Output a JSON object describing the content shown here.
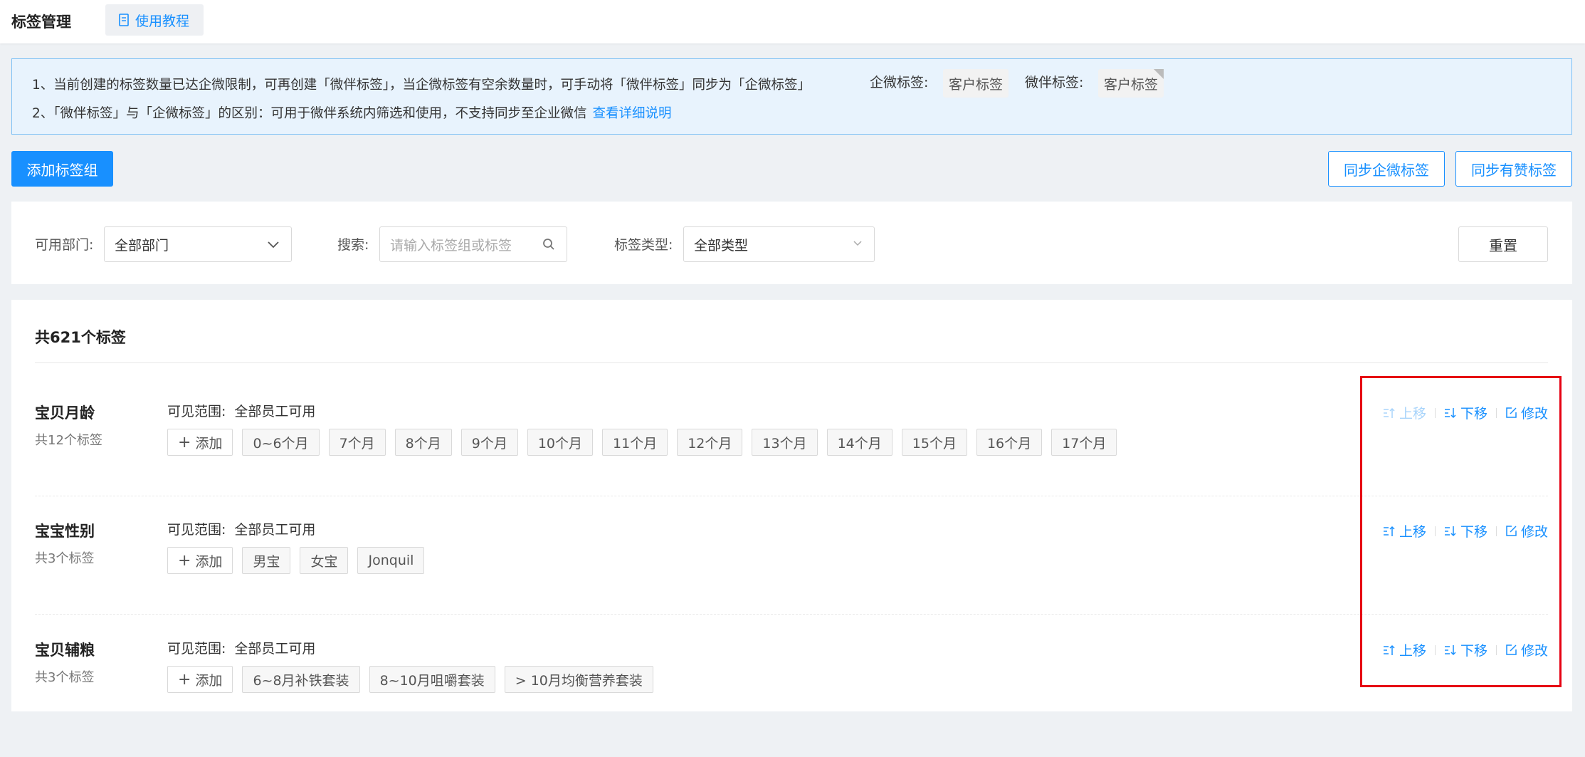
{
  "header": {
    "title": "标签管理",
    "tutorial_label": "使用教程"
  },
  "notice": {
    "line1": "1、当前创建的标签数量已达企微限制，可再创建「微伴标签」，当企微标签有空余数量时，可手动将「微伴标签」同步为「企微标签」",
    "line2": "2、「微伴标签」与「企微标签」的区别：可用于微伴系统内筛选和使用，不支持同步至企业微信",
    "line2_link": "查看详细说明",
    "qiwei_label": "企微标签:",
    "qiwei_chip": "客户标签",
    "weiban_label": "微伴标签:",
    "weiban_chip": "客户标签"
  },
  "toolbar": {
    "add_group": "添加标签组",
    "sync_qiwei": "同步企微标签",
    "sync_youzan": "同步有赞标签"
  },
  "filters": {
    "dept_label": "可用部门:",
    "dept_value": "全部部门",
    "search_label": "搜索:",
    "search_placeholder": "请输入标签组或标签",
    "type_label": "标签类型:",
    "type_value": "全部类型",
    "reset": "重置"
  },
  "list": {
    "total": "共621个标签",
    "scope_label": "可见范围:",
    "add_label": "添加",
    "actions": {
      "up": "上移",
      "down": "下移",
      "edit": "修改"
    },
    "groups": [
      {
        "name": "宝贝月龄",
        "count": "共12个标签",
        "scope": "全部员工可用",
        "tags": [
          "0~6个月",
          "7个月",
          "8个月",
          "9个月",
          "10个月",
          "11个月",
          "12个月",
          "13个月",
          "14个月",
          "15个月",
          "16个月",
          "17个月"
        ]
      },
      {
        "name": "宝宝性别",
        "count": "共3个标签",
        "scope": "全部员工可用",
        "tags": [
          "男宝",
          "女宝",
          "Jonquil"
        ]
      },
      {
        "name": "宝贝辅粮",
        "count": "共3个标签",
        "scope": "全部员工可用",
        "tags": [
          "6~8月补铁套装",
          "8~10月咀嚼套装",
          "> 10月均衡营养套装"
        ]
      }
    ]
  },
  "colors": {
    "primary": "#1890ff",
    "highlight_box": "#e60012"
  }
}
